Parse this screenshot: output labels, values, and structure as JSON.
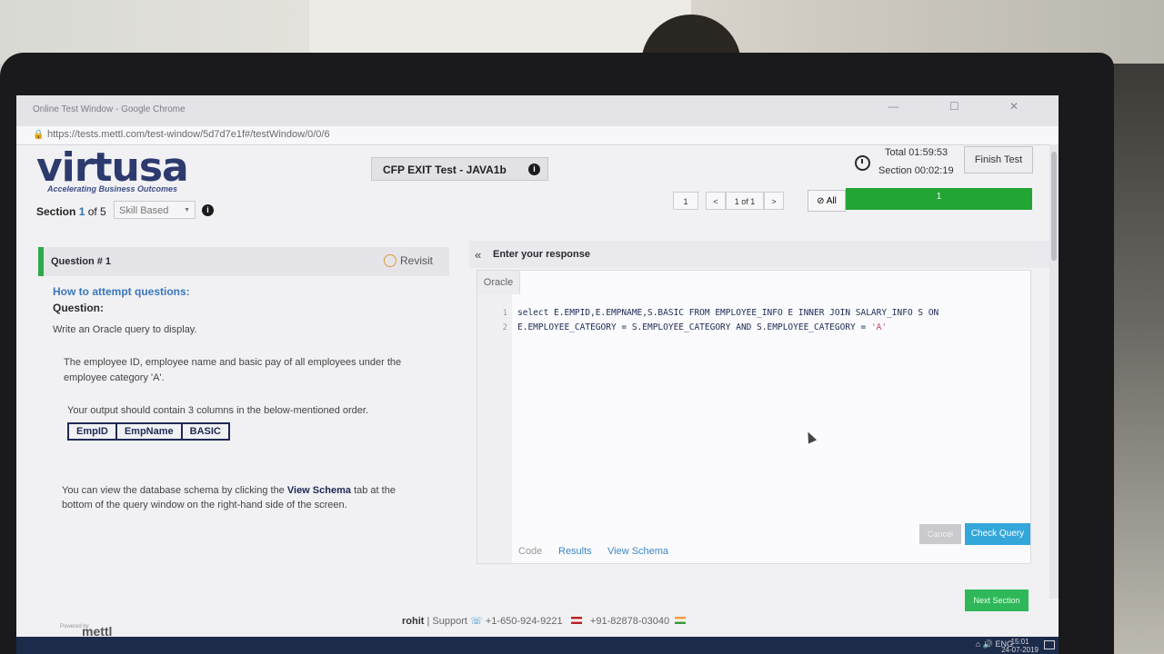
{
  "window": {
    "title": "Online Test Window - Google Chrome",
    "url": "https://tests.mettl.com/test-window/5d7d7e1f#/testWindow/0/0/6",
    "controls": "— ☐ ✕"
  },
  "brand": {
    "logo": "virtusa",
    "tagline": "Accelerating Business Outcomes",
    "powered_by": "Powered by",
    "mettl": "mettl"
  },
  "header": {
    "test_name": "CFP EXIT Test - JAVA1b",
    "info": "i",
    "total_time": "Total 01:59:53",
    "section_time": "Section 00:02:19",
    "finish_button": "Finish Test",
    "section_label_prefix": "Section",
    "section_current": "1",
    "section_of": "of 5",
    "skill_select": "Skill Based",
    "pager_current": "1",
    "pager_prev": "<",
    "pager_range": "1 of 1",
    "pager_next": ">",
    "all_filter": "⊘ All",
    "progress_label": "1",
    "progress_fraction": 1.0
  },
  "question": {
    "title": "Question # 1",
    "revisit": "Revisit",
    "how_to": "How to attempt questions:",
    "label": "Question:",
    "intro": "Write an Oracle query to display.",
    "task_line1": "The employee ID, employee name and basic pay of all employees under the",
    "task_line2": "employee category 'A'.",
    "output_note": "Your output should contain 3 columns in the below-mentioned order.",
    "columns": [
      "EmpID",
      "EmpName",
      "BASIC"
    ],
    "schema_line1_a": "You can view the database schema by clicking the",
    "schema_link": "View Schema",
    "schema_line1_b": "tab at the",
    "schema_line2": "bottom of the query window on the right-hand side of the screen."
  },
  "response": {
    "title": "Enter your response",
    "language": "Oracle",
    "lines": [
      {
        "num": "1",
        "code": "select E.EMPID,E.EMPNAME,S.BASIC FROM EMPLOYEE_INFO E INNER JOIN SALARY_INFO S ON"
      },
      {
        "num": "2",
        "code": "E.EMPLOYEE_CATEGORY = S.EMPLOYEE_CATEGORY AND S.EMPLOYEE_CATEGORY = ",
        "str": "'A'"
      }
    ],
    "tabs": [
      "Code",
      "Results",
      "View Schema"
    ],
    "cancel": "Cancel",
    "check_query": "Check Query",
    "next_section": "Next Section"
  },
  "footer": {
    "user": "rohit",
    "support": "| Support",
    "phone_us": "+1-650-924-9221",
    "phone_in": "+91-82878-03040"
  },
  "taskbar": {
    "lang": "ENG",
    "time": "15:01",
    "date": "24-07-2019"
  },
  "colors": {
    "accent_green": "#2fa84a",
    "progress_green": "#23a534",
    "link_blue": "#3b76bb",
    "check_blue": "#34a7da",
    "logo_navy": "#2d3a6e"
  }
}
